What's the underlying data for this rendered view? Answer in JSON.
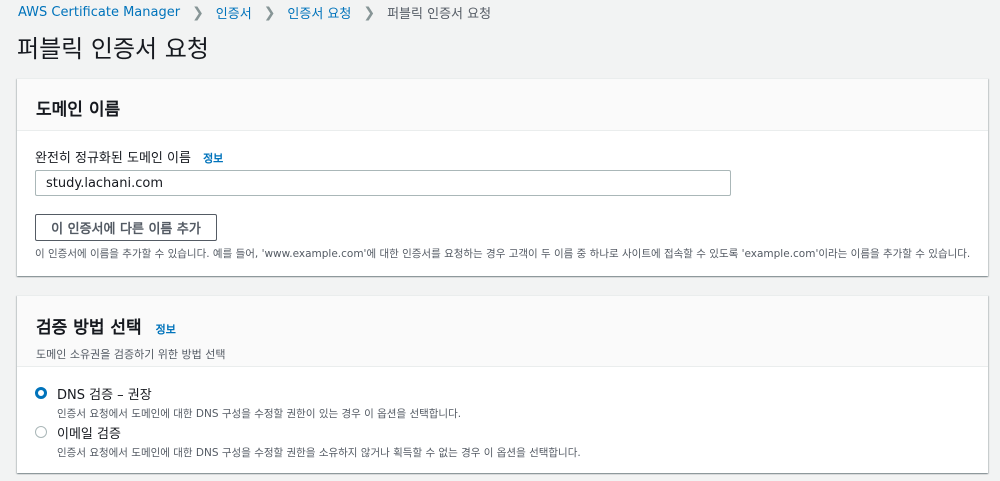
{
  "breadcrumb": {
    "item1": "AWS Certificate Manager",
    "item2": "인증서",
    "item3": "인증서 요청",
    "current": "퍼블릭 인증서 요청"
  },
  "page_title": "퍼블릭 인증서 요청",
  "domain_panel": {
    "title": "도메인 이름",
    "field_label": "완전히 정규화된 도메인 이름",
    "info": "정보",
    "domain_value": "study.lachani.com",
    "add_button": "이 인증서에 다른 이름 추가",
    "help_text": "이 인증서에 이름을 추가할 수 있습니다. 예를 들어, 'www.example.com'에 대한 인증서를 요청하는 경우 고객이 두 이름 중 하나로 사이트에 접속할 수 있도록 'example.com'이라는 이름을 추가할 수 있습니다."
  },
  "validation_panel": {
    "title": "검증 방법 선택",
    "info": "정보",
    "description": "도메인 소유권을 검증하기 위한 방법 선택",
    "options": [
      {
        "label": "DNS 검증 – 권장",
        "desc": "인증서 요청에서 도메인에 대한 DNS 구성을 수정할 권한이 있는 경우 이 옵션을 선택합니다.",
        "selected": true
      },
      {
        "label": "이메일 검증",
        "desc": "인증서 요청에서 도메인에 대한 DNS 구성을 수정할 권한을 소유하지 않거나 획득할 수 없는 경우 이 옵션을 선택합니다.",
        "selected": false
      }
    ]
  },
  "colors": {
    "link": "#0073bb",
    "background": "#f2f3f3",
    "text": "#16191f",
    "secondary_text": "#545b64"
  }
}
